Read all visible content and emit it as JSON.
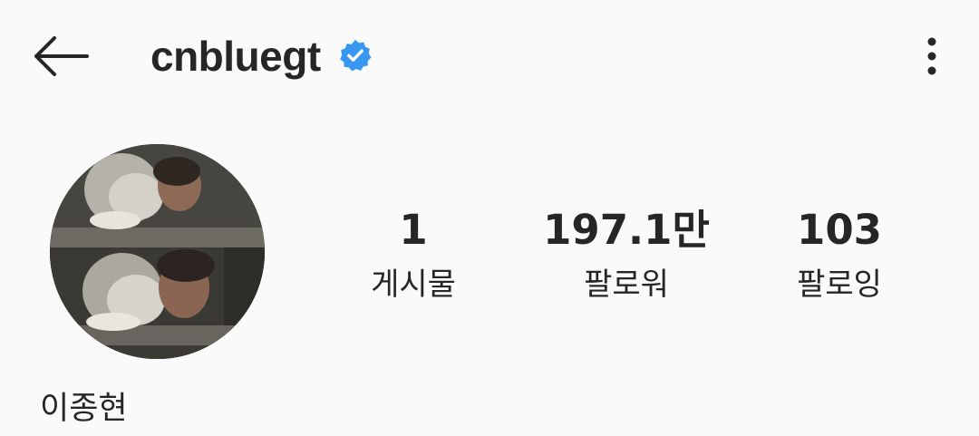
{
  "header": {
    "username": "cnbluegt",
    "back_icon": "arrow-left-icon",
    "verified_icon": "verified-badge-icon",
    "verified_color": "#3897f0",
    "more_icon": "vertical-dots-icon"
  },
  "profile": {
    "avatar_icon": "profile-photo",
    "full_name": "이종현"
  },
  "stats": {
    "posts": {
      "value": "1",
      "label": "게시물"
    },
    "followers": {
      "value": "197.1만",
      "label": "팔로워"
    },
    "following": {
      "value": "103",
      "label": "팔로잉"
    }
  }
}
